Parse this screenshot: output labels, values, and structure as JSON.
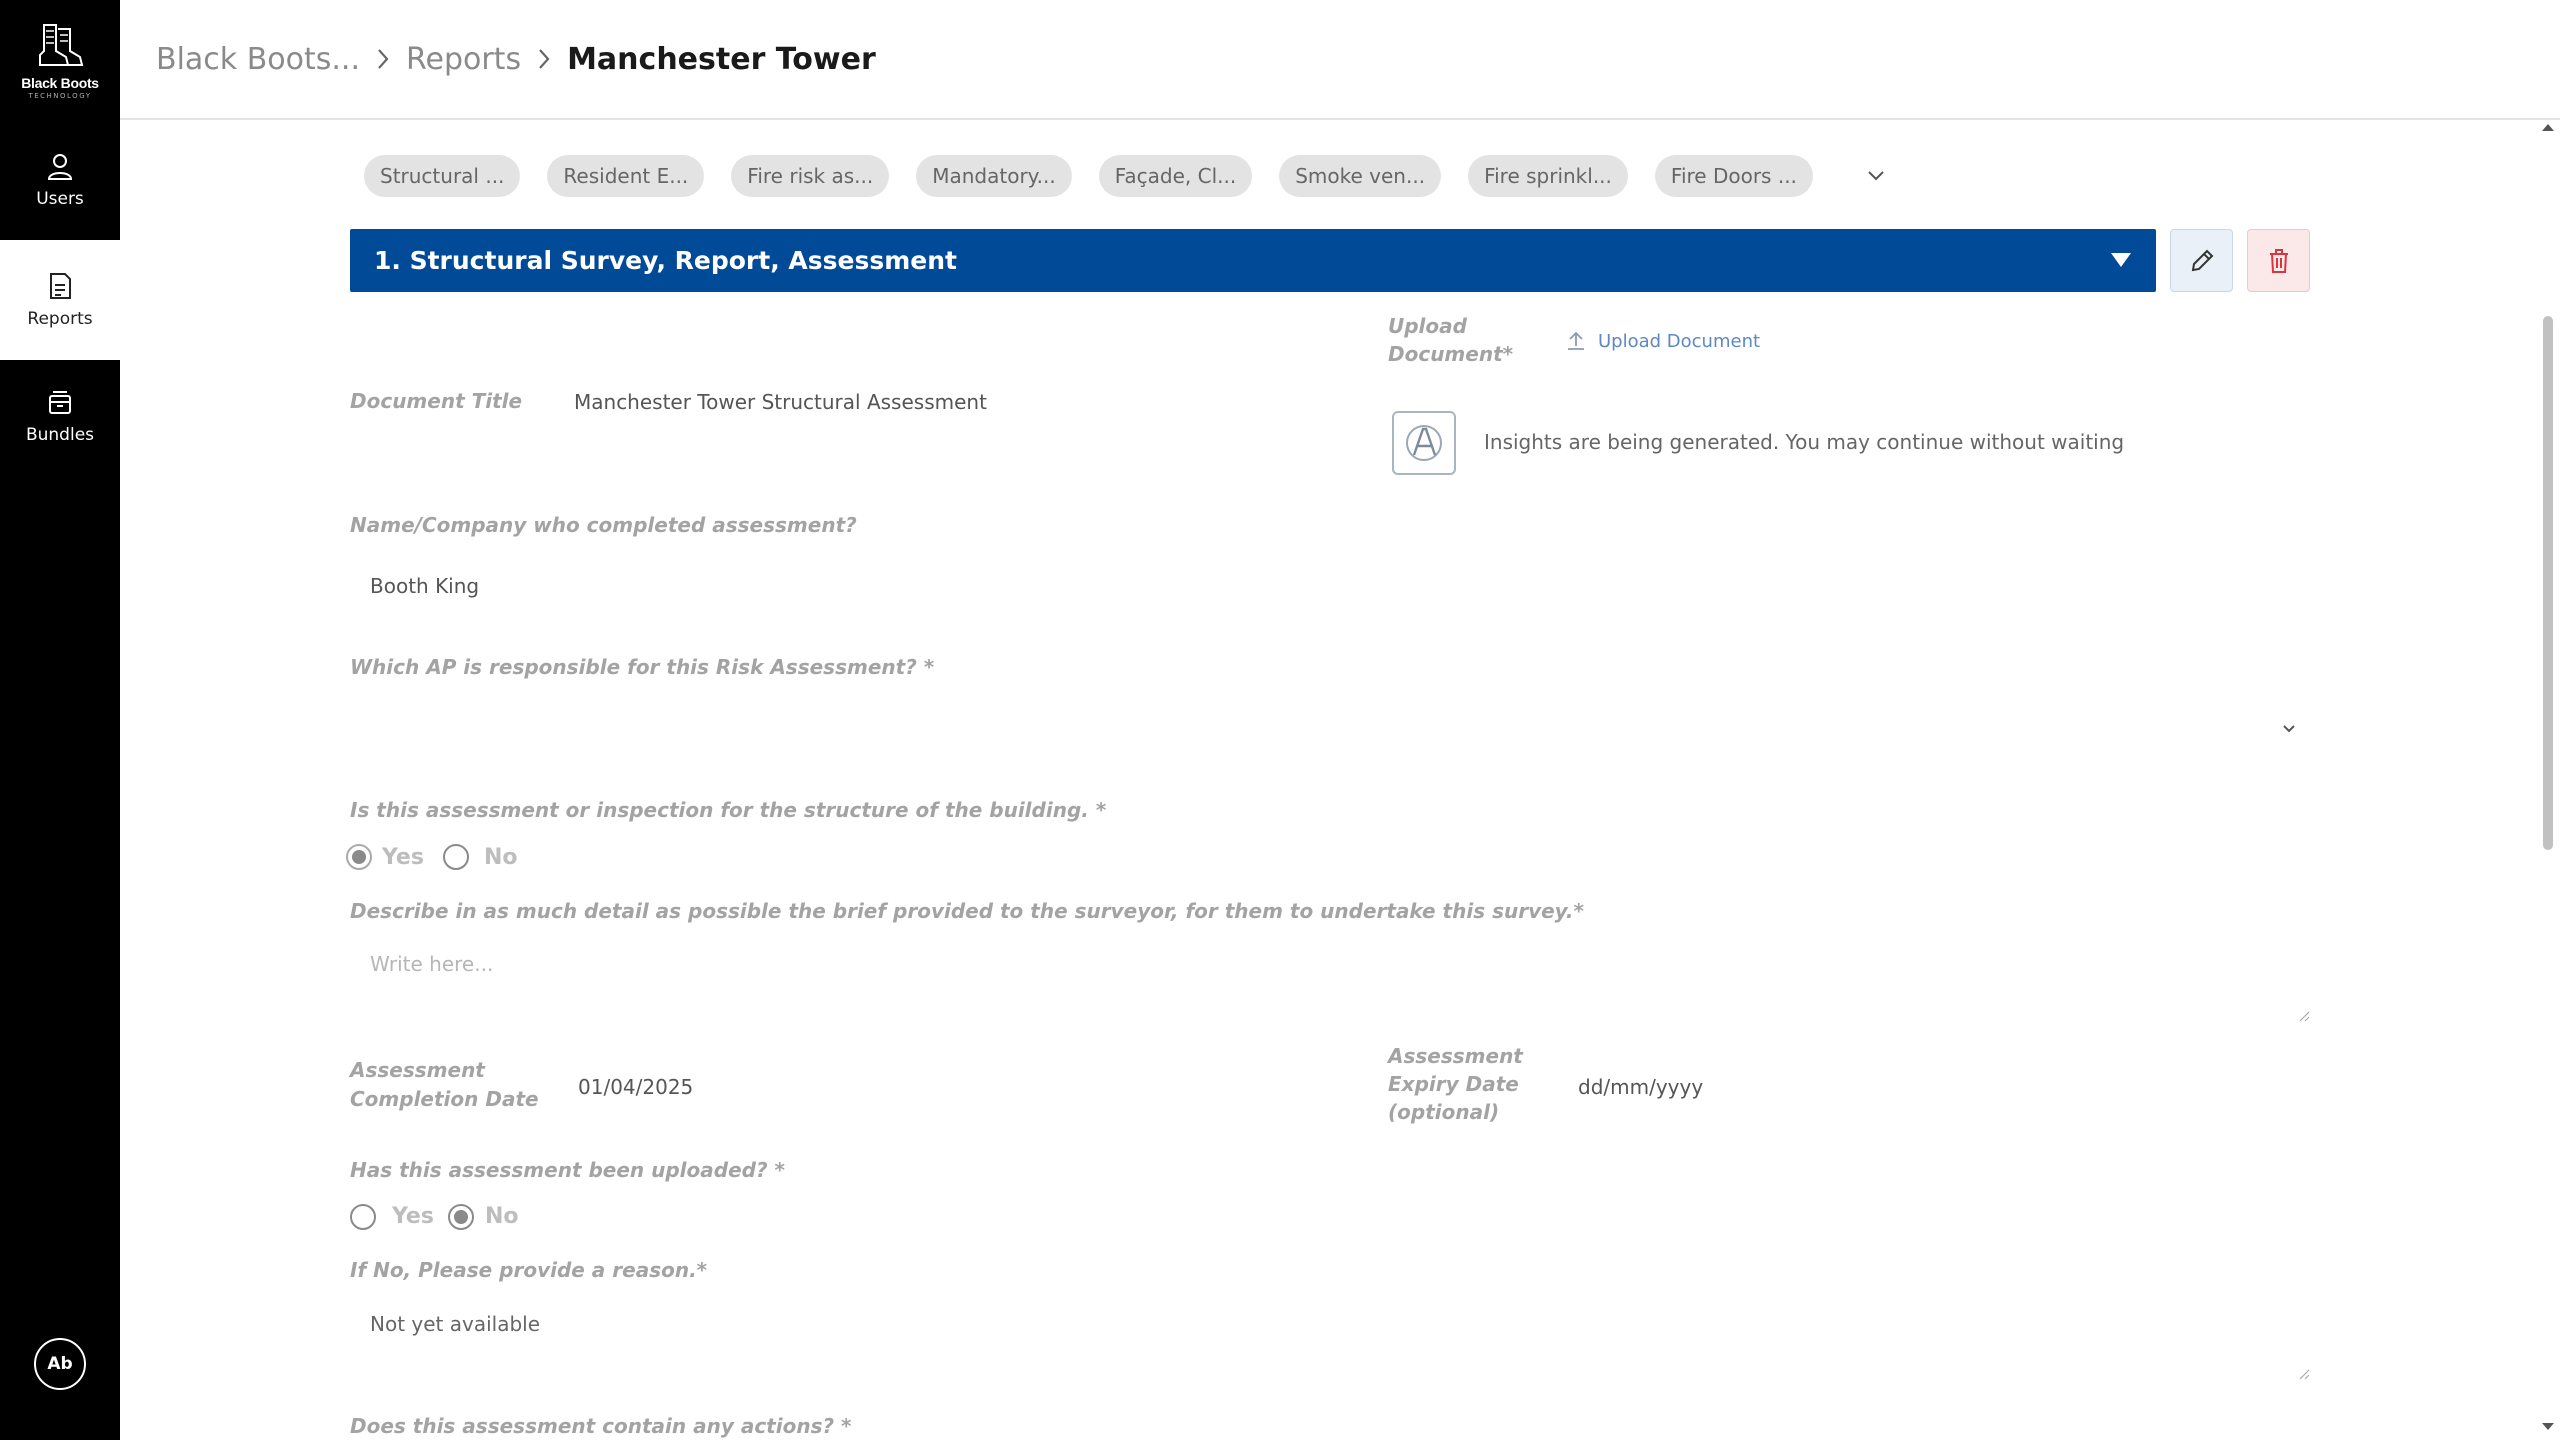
{
  "app": {
    "logo_text": "Black Boots",
    "logo_subtext": "TECHNOLOGY"
  },
  "sidebar": {
    "items": [
      {
        "label": "Users",
        "icon": "user-icon"
      },
      {
        "label": "Reports",
        "icon": "report-icon",
        "active": true
      },
      {
        "label": "Bundles",
        "icon": "bundle-icon"
      }
    ],
    "avatar_initials": "Ab"
  },
  "breadcrumb": {
    "items": [
      "Black Boots...",
      "Reports"
    ],
    "current": "Manchester Tower"
  },
  "tabs": [
    "Structural ...",
    "Resident E...",
    "Fire risk as...",
    "Mandatory...",
    "Façade, Cl...",
    "Smoke ven...",
    "Fire sprinkl...",
    "Fire Doors ..."
  ],
  "section": {
    "title": "1. Structural Survey, Report, Assessment"
  },
  "form": {
    "upload_label_line1": "Upload",
    "upload_label_line2": "Document*",
    "upload_link": "Upload Document",
    "document_title_label": "Document Title",
    "document_title_value": "Manchester Tower Structural Assessment",
    "insights_text": "Insights are being generated. You may continue without waiting",
    "company_label": "Name/Company who completed assessment?",
    "company_value": "Booth King",
    "ap_label": "Which AP is responsible for this Risk Assessment? *",
    "structure_question": "Is this assessment or inspection for the structure of the building. *",
    "yes_label": "Yes",
    "no_label": "No",
    "brief_label": "Describe in as much detail as possible the brief provided to the surveyor, for them to undertake this survey.*",
    "brief_placeholder": "Write here...",
    "completion_label_line1": "Assessment",
    "completion_label_line2": "Completion Date",
    "completion_value": "01/04/2025",
    "expiry_label_line1": "Assessment",
    "expiry_label_line2": "Expiry Date",
    "expiry_label_line3": "(optional)",
    "expiry_placeholder": "dd/mm/yyyy",
    "uploaded_question": "Has this assessment been uploaded? *",
    "reason_label": "If No, Please provide a reason.*",
    "reason_value": "Not yet available",
    "actions_question": "Does this assessment contain any actions? *"
  },
  "colors": {
    "sidebar_bg": "#000000",
    "section_bar": "#004a98",
    "delete_icon": "#d9363e",
    "link": "#5d88c2"
  }
}
